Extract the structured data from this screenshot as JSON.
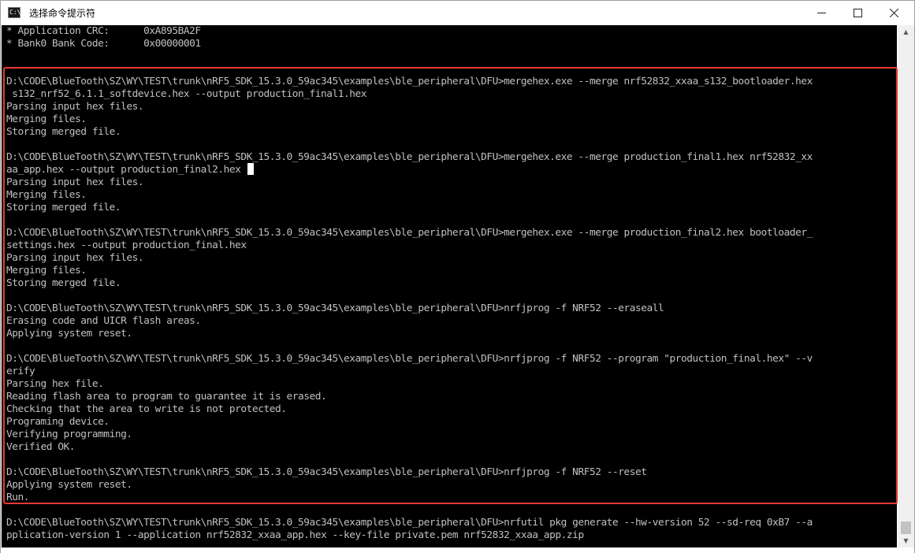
{
  "window": {
    "title": "选择命令提示符",
    "icon_label": "C:\\",
    "minimize_icon": "minimize-icon",
    "maximize_icon": "maximize-icon",
    "close_icon": "close-icon"
  },
  "console": {
    "lines": [
      "* Application CRC:      0xA895BA2F",
      "* Bank0 Bank Code:      0x00000001",
      "",
      "",
      "D:\\CODE\\BlueTooth\\SZ\\WY\\TEST\\trunk\\nRF5_SDK_15.3.0_59ac345\\examples\\ble_peripheral\\DFU>mergehex.exe --merge nrf52832_xxaa_s132_bootloader.hex",
      " s132_nrf52_6.1.1_softdevice.hex --output production_final1.hex",
      "Parsing input hex files.",
      "Merging files.",
      "Storing merged file.",
      "",
      "D:\\CODE\\BlueTooth\\SZ\\WY\\TEST\\trunk\\nRF5_SDK_15.3.0_59ac345\\examples\\ble_peripheral\\DFU>mergehex.exe --merge production_final1.hex nrf52832_xx",
      "aa_app.hex --output production_final2.hex",
      "Parsing input hex files.",
      "Merging files.",
      "Storing merged file.",
      "",
      "D:\\CODE\\BlueTooth\\SZ\\WY\\TEST\\trunk\\nRF5_SDK_15.3.0_59ac345\\examples\\ble_peripheral\\DFU>mergehex.exe --merge production_final2.hex bootloader_",
      "settings.hex --output production_final.hex",
      "Parsing input hex files.",
      "Merging files.",
      "Storing merged file.",
      "",
      "D:\\CODE\\BlueTooth\\SZ\\WY\\TEST\\trunk\\nRF5_SDK_15.3.0_59ac345\\examples\\ble_peripheral\\DFU>nrfjprog -f NRF52 --eraseall",
      "Erasing code and UICR flash areas.",
      "Applying system reset.",
      "",
      "D:\\CODE\\BlueTooth\\SZ\\WY\\TEST\\trunk\\nRF5_SDK_15.3.0_59ac345\\examples\\ble_peripheral\\DFU>nrfjprog -f NRF52 --program \"production_final.hex\" --v",
      "erify",
      "Parsing hex file.",
      "Reading flash area to program to guarantee it is erased.",
      "Checking that the area to write is not protected.",
      "Programing device.",
      "Verifying programming.",
      "Verified OK.",
      "",
      "D:\\CODE\\BlueTooth\\SZ\\WY\\TEST\\trunk\\nRF5_SDK_15.3.0_59ac345\\examples\\ble_peripheral\\DFU>nrfjprog -f NRF52 --reset",
      "Applying system reset.",
      "Run.",
      "",
      "D:\\CODE\\BlueTooth\\SZ\\WY\\TEST\\trunk\\nRF5_SDK_15.3.0_59ac345\\examples\\ble_peripheral\\DFU>nrfutil pkg generate --hw-version 52 --sd-req 0xB7 --a",
      "pplication-version 1 --application nrf52832_xxaa_app.hex --key-file private.pem nrf52832_xxaa_app.zip"
    ]
  },
  "colors": {
    "console_bg": "#000000",
    "console_text": "#c0c0c0",
    "highlight_border": "#e53935"
  }
}
